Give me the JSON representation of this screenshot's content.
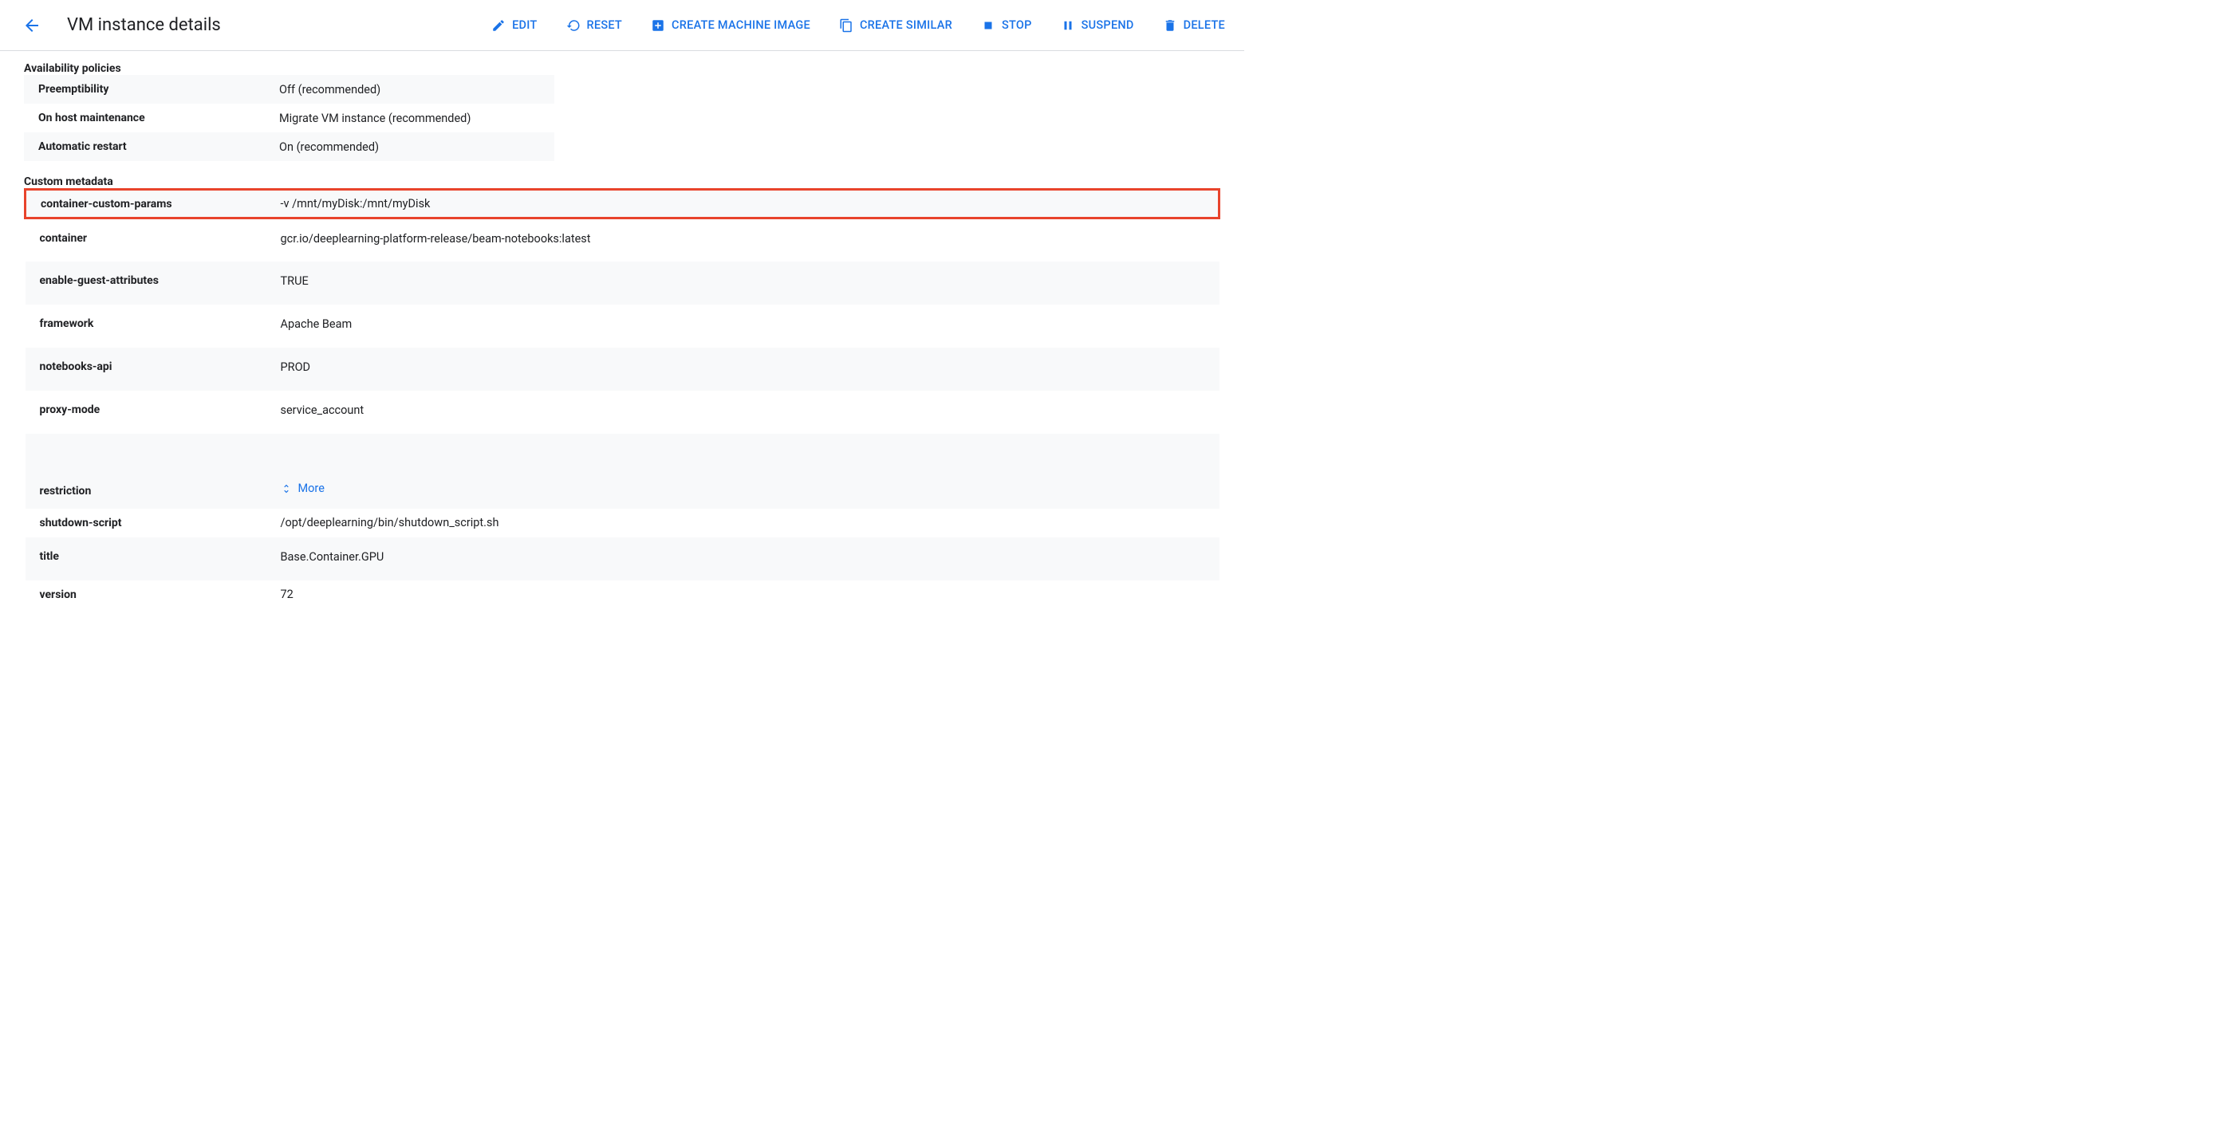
{
  "header": {
    "title": "VM instance details",
    "actions": {
      "edit": "EDIT",
      "reset": "RESET",
      "create_machine_image": "CREATE MACHINE IMAGE",
      "create_similar": "CREATE SIMILAR",
      "stop": "STOP",
      "suspend": "SUSPEND",
      "delete": "DELETE"
    }
  },
  "sections": {
    "availability": {
      "title": "Availability policies",
      "rows": [
        {
          "key": "Preemptibility",
          "value": "Off (recommended)"
        },
        {
          "key": "On host maintenance",
          "value": "Migrate VM instance (recommended)"
        },
        {
          "key": "Automatic restart",
          "value": "On (recommended)"
        }
      ]
    },
    "metadata": {
      "title": "Custom metadata",
      "rows": [
        {
          "key": "container-custom-params",
          "value": "-v /mnt/myDisk:/mnt/myDisk",
          "highlight": true
        },
        {
          "key": "container",
          "value": "gcr.io/deeplearning-platform-release/beam-notebooks:latest"
        },
        {
          "key": "enable-guest-attributes",
          "value": "TRUE"
        },
        {
          "key": "framework",
          "value": "Apache Beam"
        },
        {
          "key": "notebooks-api",
          "value": "PROD"
        },
        {
          "key": "proxy-mode",
          "value": "service_account"
        },
        {
          "key": "restriction",
          "value": "More",
          "more": true
        },
        {
          "key": "shutdown-script",
          "value": "/opt/deeplearning/bin/shutdown_script.sh"
        },
        {
          "key": "title",
          "value": "Base.Container.GPU"
        },
        {
          "key": "version",
          "value": "72"
        }
      ]
    }
  }
}
